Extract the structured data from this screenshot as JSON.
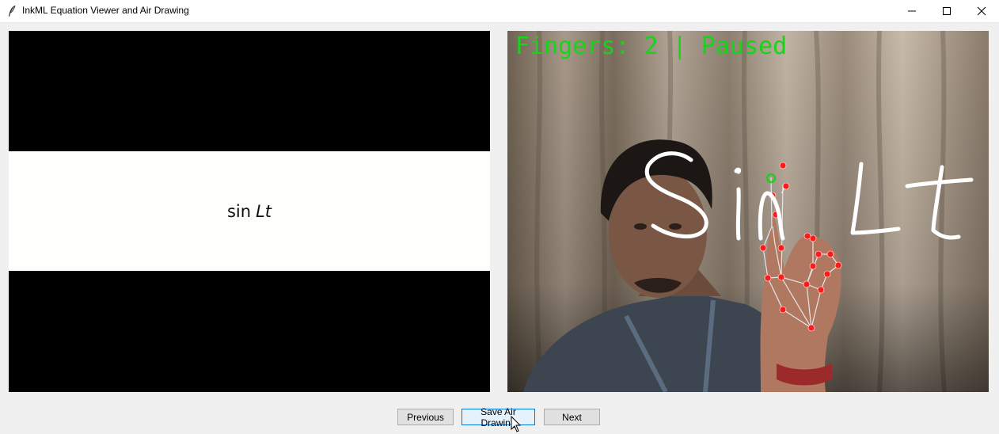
{
  "window": {
    "title": "InkML Equation Viewer and Air Drawing",
    "app_icon": "feather-icon",
    "controls": [
      "minimize-icon",
      "maximize-icon",
      "close-icon"
    ]
  },
  "equation_panel": {
    "function": "sin",
    "arguments": "Lt"
  },
  "camera_panel": {
    "status_text": "Fingers: 2 | Paused",
    "status_color": "#16d416",
    "drawing_color": "#ffffff",
    "landmark_color": "#ff1a1a"
  },
  "buttons": {
    "previous": "Previous",
    "save": "Save Air Drawing",
    "next": "Next"
  }
}
